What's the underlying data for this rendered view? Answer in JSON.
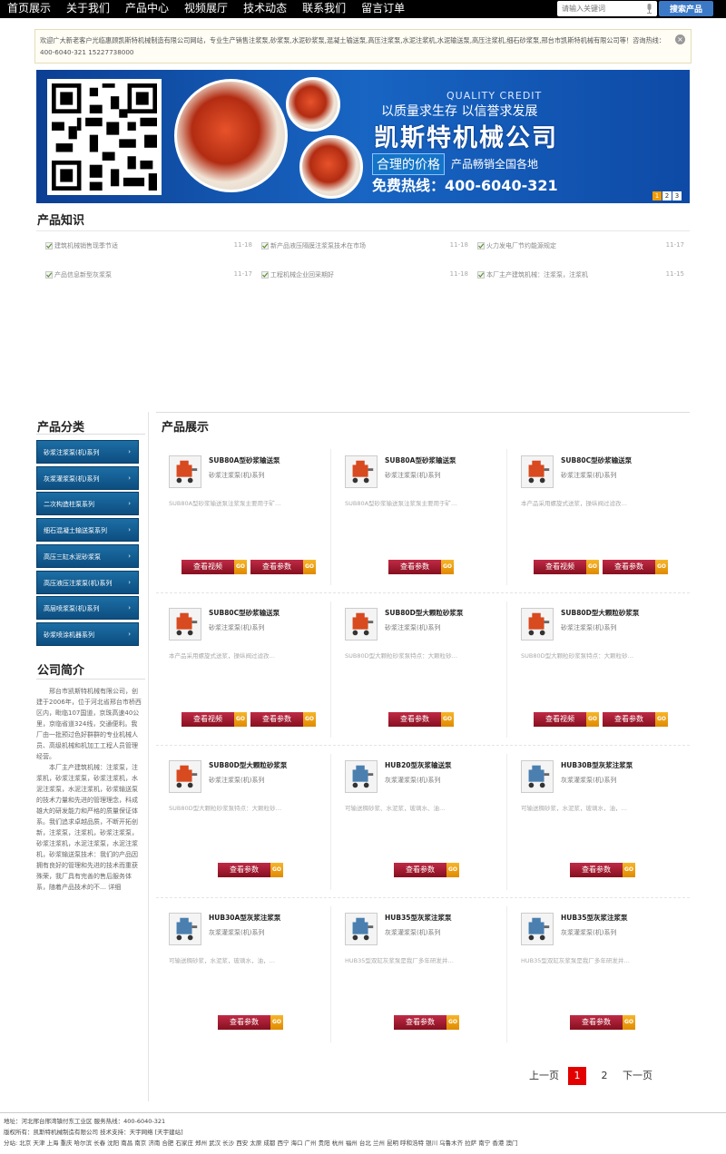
{
  "nav": [
    "首页展示",
    "关于我们",
    "产品中心",
    "视频展厅",
    "技术动态",
    "联系我们",
    "留言订单"
  ],
  "search": {
    "placeholder": "请输入关键词",
    "button": "搜索产品"
  },
  "welcome_text": "欢迎广大新老客户光临惠顾凯斯特机械制造有限公司网站，专业生产销售注浆泵,砂浆泵,水泥砂浆泵,混凝土输送泵,高压注浆泵,水泥注浆机,水泥输送泵,高压注浆机,细石砂浆泵,邢台市凯斯特机械有限公司等！咨询热线：400-6040-321 15227738000",
  "banner": {
    "en": "QUALITY CREDIT",
    "slogan": "以质量求生存 以信誉求发展",
    "company": "凯斯特机械公司",
    "price": "合理的价格",
    "sales": "产品畅销全国各地",
    "hotline": "免费热线：400-6040-321",
    "pages": [
      "1",
      "2",
      "3"
    ]
  },
  "knowledge": {
    "title": "产品知识",
    "items": [
      {
        "title": "建筑机械销售现季节适",
        "date": "11-18"
      },
      {
        "title": "新产品液压隔膜注浆泵技术在市场",
        "date": "11-18"
      },
      {
        "title": "火力发电厂节约能源规定",
        "date": "11-17"
      },
      {
        "title": "产品信息新型灰浆泵",
        "date": "11-17"
      },
      {
        "title": "工程机械企业回采期好",
        "date": "11-18"
      },
      {
        "title": "本厂主产建筑机械：注浆泵，注浆机",
        "date": "11-15"
      }
    ]
  },
  "categories": {
    "title": "产品分类",
    "items": [
      "砂浆注浆泵(机)系列",
      "灰浆灌浆泵(机)系列",
      "二次构造柱泵系列",
      "细石混凝土输送泵系列",
      "高压三缸水泥砂浆泵",
      "高压液压注浆泵(机)系列",
      "高层喷浆泵(机)系列",
      "砂浆喷涂机器系列"
    ]
  },
  "about": {
    "title": "公司简介",
    "paragraphs": [
      "邢台市凯斯特机械有限公司，创建于2006年，位于河北省邢台市桥西区内，毗临107国道，京珠高速40公里，京临省道324线，交通便利。我厂由一批预过色好群群的专业机械人员、高级机械和机加工工程人员管理经营。",
      "本厂主产建筑机械：注浆泵，注浆机，砂浆注浆泵，砂浆注浆机，水泥注浆泵，水泥注浆机，砂浆输送泵的技术力量和先进的管理理念，科成雄大的研发能力和严格的质量保证体系。我们追求卓越品质，不断开拓创新，注浆泵，注浆机，砂浆注浆泵，砂浆注浆机，水泥注浆泵，水泥注浆机，砂浆输送泵技术：我们的产品因拥有良好的管理和先进的技术而重获殊荣，我厂具有完善的售后服务体系，随着产品技术的不…"
    ],
    "more": "详细"
  },
  "products": {
    "title": "产品展示",
    "items": [
      {
        "name": "SUB80A型砂浆输送泵",
        "cat": "砂浆注浆泵(机)系列",
        "desc": "SUB80A型砂浆输送泵注浆泵主要用于矿…",
        "buttons": [
          "查看视频",
          "查看参数"
        ]
      },
      {
        "name": "SUB80A型砂浆输送泵",
        "cat": "砂浆注浆泵(机)系列",
        "desc": "SUB80A型砂浆输送泵注浆泵主要用于矿…",
        "buttons": [
          "查看参数"
        ]
      },
      {
        "name": "SUB80C型砂浆输送泵",
        "cat": "砂浆注浆泵(机)系列",
        "desc": "本产品采用螺旋式送浆，操纵阀过滤孜…",
        "buttons": [
          "查看视频",
          "查看参数"
        ]
      },
      {
        "name": "SUB80C型砂浆输送泵",
        "cat": "砂浆注浆泵(机)系列",
        "desc": "本产品采用螺旋式送浆，操纵阀过滤孜…",
        "buttons": [
          "查看视频",
          "查看参数"
        ]
      },
      {
        "name": "SUB80D型大颗粒砂浆泵",
        "cat": "砂浆注浆泵(机)系列",
        "desc": "SUB80D型大颗粒砂浆泵特点：大颗粒砂…",
        "buttons": [
          "查看参数"
        ]
      },
      {
        "name": "SUB80D型大颗粒砂浆泵",
        "cat": "砂浆注浆泵(机)系列",
        "desc": "SUB80D型大颗粒砂浆泵特点：大颗粒砂…",
        "buttons": [
          "查看视频",
          "查看参数"
        ]
      },
      {
        "name": "SUB80D型大颗粒砂浆泵",
        "cat": "砂浆注浆泵(机)系列",
        "desc": "SUB80D型大颗粒砂浆泵特点：大颗粒砂…",
        "buttons": [
          "查看参数"
        ]
      },
      {
        "name": "HUB20型灰浆输送泵",
        "cat": "灰浆灌浆泵(机)系列",
        "desc": "可输送稠砂浆、水泥浆，玻璃水、油…",
        "buttons": [
          "查看参数"
        ]
      },
      {
        "name": "HUB30B型灰浆注浆泵",
        "cat": "灰浆灌浆泵(机)系列",
        "desc": "可输送稠砂浆，水泥浆，玻璃水，油，…",
        "buttons": [
          "查看参数"
        ]
      },
      {
        "name": "HUB30A型灰浆注浆泵",
        "cat": "灰浆灌浆泵(机)系列",
        "desc": "可输送稠砂浆，水泥浆，玻璃水，油，…",
        "buttons": [
          "查看参数"
        ]
      },
      {
        "name": "HUB35型灰浆注浆泵",
        "cat": "灰浆灌浆泵(机)系列",
        "desc": "HUB35型双缸灰浆泵是我厂多年研发并…",
        "buttons": [
          "查看参数"
        ]
      },
      {
        "name": "HUB35型灰浆注浆泵",
        "cat": "灰浆灌浆泵(机)系列",
        "desc": "HUB35型双缸灰浆泵是我厂多年研发并…",
        "buttons": [
          "查看参数"
        ]
      }
    ]
  },
  "pagination": {
    "prev": "上一页",
    "pages": [
      "1",
      "2"
    ],
    "current": "1",
    "next": "下一页"
  },
  "footer": {
    "line1": "地址：河北邢台邢湾镇付东工业区  服务热线：400-6040-321",
    "line2": "版权所有：凯斯特机械制造有限公司  技术支持：天宇网络 [天宇建站]",
    "line3": "分站: 北京 天津 上海 重庆 哈尔滨 长春 沈阳 南昌 南京 济南 合肥 石家庄 郑州 武汉 长沙 西安 太原 成都 西宁 海口 广州 贵阳 杭州 福州 台北 兰州 昆明 呼和浩特 银川 乌鲁木齐 拉萨 南宁 香港 澳门"
  },
  "colors": {
    "accent": "#3b79c7",
    "category": "#0d4e80",
    "button": "#a81c34",
    "go": "#f0a010",
    "current_page": "#e30000"
  }
}
